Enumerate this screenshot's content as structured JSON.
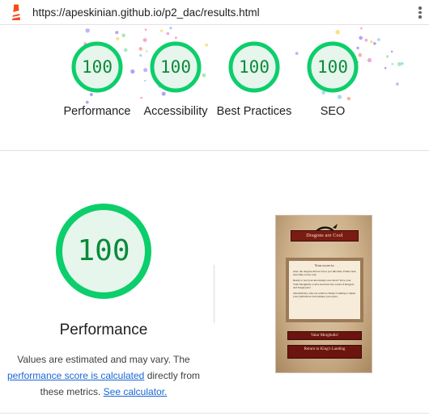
{
  "browser": {
    "url": "https://apeskinian.github.io/p2_dac/results.html",
    "menu_icon": "more-vert-icon",
    "site_icon": "lighthouse-icon"
  },
  "colors": {
    "pass_green": "#0cce6b",
    "pass_fill": "#e6f6ec",
    "pass_text": "#0a8a3a",
    "link_blue": "#1a66d6"
  },
  "categories": [
    {
      "label": "Performance",
      "score": "100"
    },
    {
      "label": "Accessibility",
      "score": "100"
    },
    {
      "label": "Best Practices",
      "score": "100"
    },
    {
      "label": "SEO",
      "score": "100"
    }
  ],
  "main_gauge": {
    "score": "100",
    "title": "Performance"
  },
  "description": {
    "part1": "Values are estimated and may vary. The",
    "link1": "performance score is calculated",
    "part2": "directly from these metrics.",
    "link2": "See calculator."
  },
  "screenshot": {
    "site_title": "Dragons are Cool",
    "card_title": "Your score is:",
    "card_line1": "Alas, the dragons did not favor you this time. Father luck next time, brave soul.",
    "card_line2": "Ready to test your knowledge once more? Give your Valar Morghulis to dive back into the world of Dragons and Targaryens!",
    "card_line3": "Alternatively, why not return to King's Landing to adjust your preferences and reshape your quest.",
    "button1": "Valar Morghulis!",
    "button2": "Return to King's Landing"
  }
}
